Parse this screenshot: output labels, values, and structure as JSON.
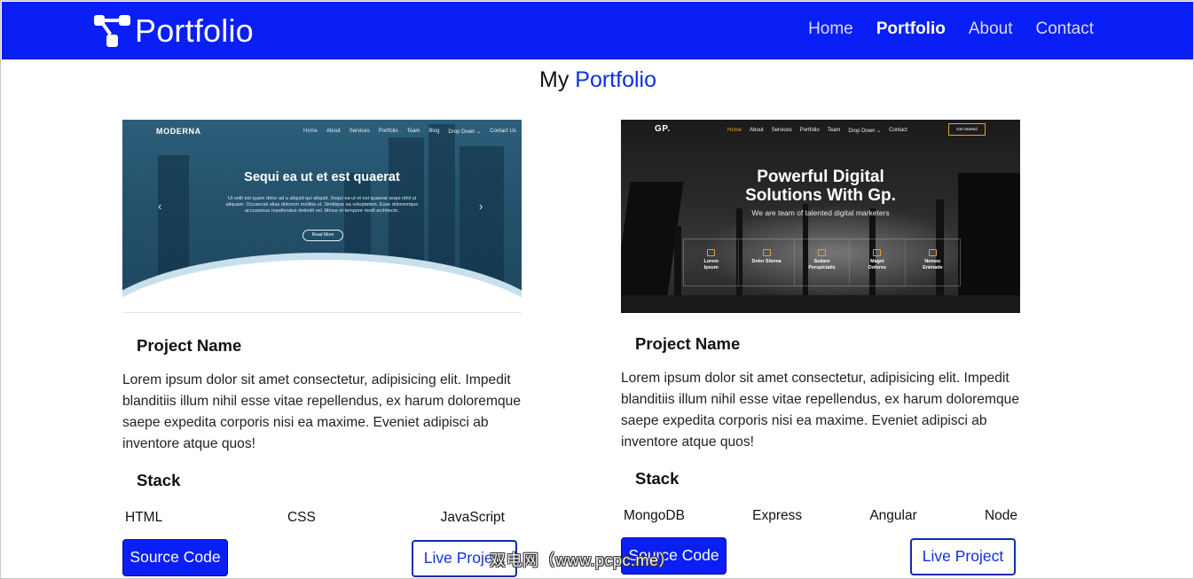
{
  "navbar": {
    "brand": "Portfolio",
    "links": [
      "Home",
      "Portfolio",
      "About",
      "Contact"
    ],
    "active": "Portfolio",
    "background": "#0a1ff5"
  },
  "heading": {
    "part1": "My",
    "part2": "Portfolio"
  },
  "projects": [
    {
      "screenshot": {
        "logo": "MODERNA",
        "nav": [
          "Home",
          "About",
          "Services",
          "Portfolio",
          "Team",
          "Blog",
          "Drop Down ⌄",
          "Contact Us"
        ],
        "hero_title": "Sequi ea ut et est quaerat",
        "hero_text": "Ut velit est quam dolor ad a aliquid qui aliquid. Sequi ea ut et est quaerat sequi nihil ut aliquam. Occaecati alias dolorem mollitia ut. Similique ea voluptatem. Esse doloremque accusamus repellendus deleniti vel. Minus et tempore modi architecto.",
        "hero_button": "Read More"
      },
      "name": "Project Name",
      "description": "Lorem ipsum dolor sit amet consectetur, adipisicing elit. Impedit blanditiis illum nihil esse vitae repellendus, ex harum doloremque saepe expedita corporis nisi ea maxime. Eveniet adipisci ab inventore atque quos!",
      "stack_title": "Stack",
      "stack": [
        "HTML",
        "CSS",
        "JavaScript"
      ],
      "source_label": "Source Code",
      "live_label": "Live Project"
    },
    {
      "screenshot": {
        "logo": "GP.",
        "nav": [
          "Home",
          "About",
          "Services",
          "Portfolio",
          "Team",
          "Drop Down ⌄",
          "Contact"
        ],
        "get_started": "Get Started",
        "hero_title_line1": "Powerful Digital",
        "hero_title_line2": "Solutions With Gp.",
        "hero_sub": "We are team of talented digital marketers",
        "features": [
          [
            "Lorem",
            "Ipsum"
          ],
          [
            "Dolor Sitema",
            ""
          ],
          [
            "Sedare",
            "Perspiciatis"
          ],
          [
            "Magni",
            "Dolores"
          ],
          [
            "Nemos",
            "Enimade"
          ]
        ]
      },
      "name": "Project Name",
      "description": "Lorem ipsum dolor sit amet consectetur, adipisicing elit. Impedit blanditiis illum nihil esse vitae repellendus, ex harum doloremque saepe expedita corporis nisi ea maxime. Eveniet adipisci ab inventore atque quos!",
      "stack_title": "Stack",
      "stack": [
        "MongoDB",
        "Express",
        "Angular",
        "Node"
      ],
      "source_label": "Source Code",
      "live_label": "Live Project"
    }
  ],
  "watermark": "双电网（www.pcpc.me）",
  "icons": {
    "brand": "brand-logo-icon",
    "carousel_prev": "chevron-left-icon",
    "carousel_next": "chevron-right-icon"
  }
}
